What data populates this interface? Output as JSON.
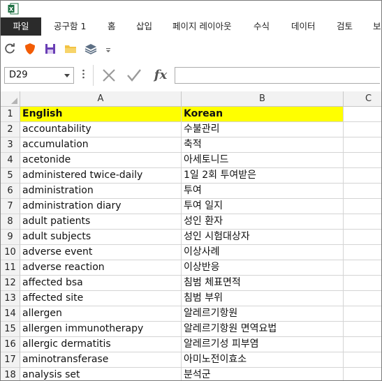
{
  "app": {
    "icon": "excel-icon"
  },
  "tabs": [
    {
      "label": "파일",
      "active": true
    },
    {
      "label": "공구함 1"
    },
    {
      "label": "홈"
    },
    {
      "label": "삽입"
    },
    {
      "label": "페이지 레이아웃"
    },
    {
      "label": "수식"
    },
    {
      "label": "데이터"
    },
    {
      "label": "검토"
    },
    {
      "label": "보"
    }
  ],
  "quick_access": [
    "refresh-icon",
    "shield-icon",
    "save-icon",
    "folder-icon",
    "layers-icon",
    "customize-icon"
  ],
  "formula_bar": {
    "name_box": "D29",
    "formula": "",
    "fx_label": "fx"
  },
  "columns": [
    "A",
    "B",
    "C"
  ],
  "rows": [
    {
      "n": "1",
      "a": "English",
      "b": "Korean"
    },
    {
      "n": "2",
      "a": "accountability",
      "b": "수불관리"
    },
    {
      "n": "3",
      "a": "accumulation",
      "b": "축적"
    },
    {
      "n": "4",
      "a": "acetonide",
      "b": "아세토니드"
    },
    {
      "n": "5",
      "a": "administered twice-daily",
      "b": "1일 2회 투여받은"
    },
    {
      "n": "6",
      "a": "administration",
      "b": "투여"
    },
    {
      "n": "7",
      "a": "administration diary",
      "b": "투여 일지"
    },
    {
      "n": "8",
      "a": "adult patients",
      "b": "성인 환자"
    },
    {
      "n": "9",
      "a": "adult subjects",
      "b": "성인 시험대상자"
    },
    {
      "n": "10",
      "a": "adverse event",
      "b": "이상사례"
    },
    {
      "n": "11",
      "a": "adverse reaction",
      "b": "이상반응"
    },
    {
      "n": "12",
      "a": "affected bsa",
      "b": "침범 체표면적"
    },
    {
      "n": "13",
      "a": "affected site",
      "b": "침범 부위"
    },
    {
      "n": "14",
      "a": "allergen",
      "b": "알레르기항원"
    },
    {
      "n": "15",
      "a": "allergen immunotherapy",
      "b": "알레르기항원 면역요법"
    },
    {
      "n": "16",
      "a": "allergic dermatitis",
      "b": "알레르기성 피부염"
    },
    {
      "n": "17",
      "a": "aminotransferase",
      "b": "아미노전이효소"
    },
    {
      "n": "18",
      "a": "analysis set",
      "b": "분석군"
    }
  ],
  "colors": {
    "header_fill": "#ffff00",
    "active_tab": "#2b2b2b"
  }
}
